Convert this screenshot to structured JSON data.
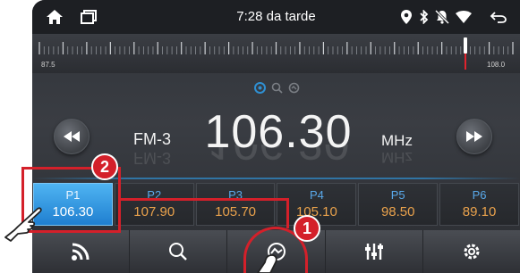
{
  "status_bar": {
    "time": "7:28 da tarde",
    "icons": [
      "home-icon",
      "recent-apps-icon",
      "location-icon",
      "bluetooth-icon",
      "notifications-off-icon",
      "wifi-icon",
      "back-icon"
    ]
  },
  "tuner": {
    "scale_min_label": "87.5",
    "scale_max_label": "108.0",
    "needle_frequency": 106.3
  },
  "display": {
    "band": "FM-3",
    "frequency": "106.30",
    "unit": "MHz"
  },
  "presets": [
    {
      "label": "P1",
      "freq": "106.30",
      "active": true
    },
    {
      "label": "P2",
      "freq": "107.90",
      "active": false
    },
    {
      "label": "P3",
      "freq": "105.70",
      "active": false
    },
    {
      "label": "P4",
      "freq": "105.10",
      "active": false
    },
    {
      "label": "P5",
      "freq": "98.50",
      "active": false
    },
    {
      "label": "P6",
      "freq": "89.10",
      "active": false
    }
  ],
  "bottom_bar": [
    "rss-icon",
    "search-icon",
    "scan-icon",
    "equalizer-icon",
    "settings-icon"
  ],
  "annotations": {
    "callout_1": "1",
    "callout_2": "2"
  },
  "colors": {
    "accent": "#2f8fd1",
    "preset_freq": "#eaa24c",
    "callout": "#d4202a"
  }
}
